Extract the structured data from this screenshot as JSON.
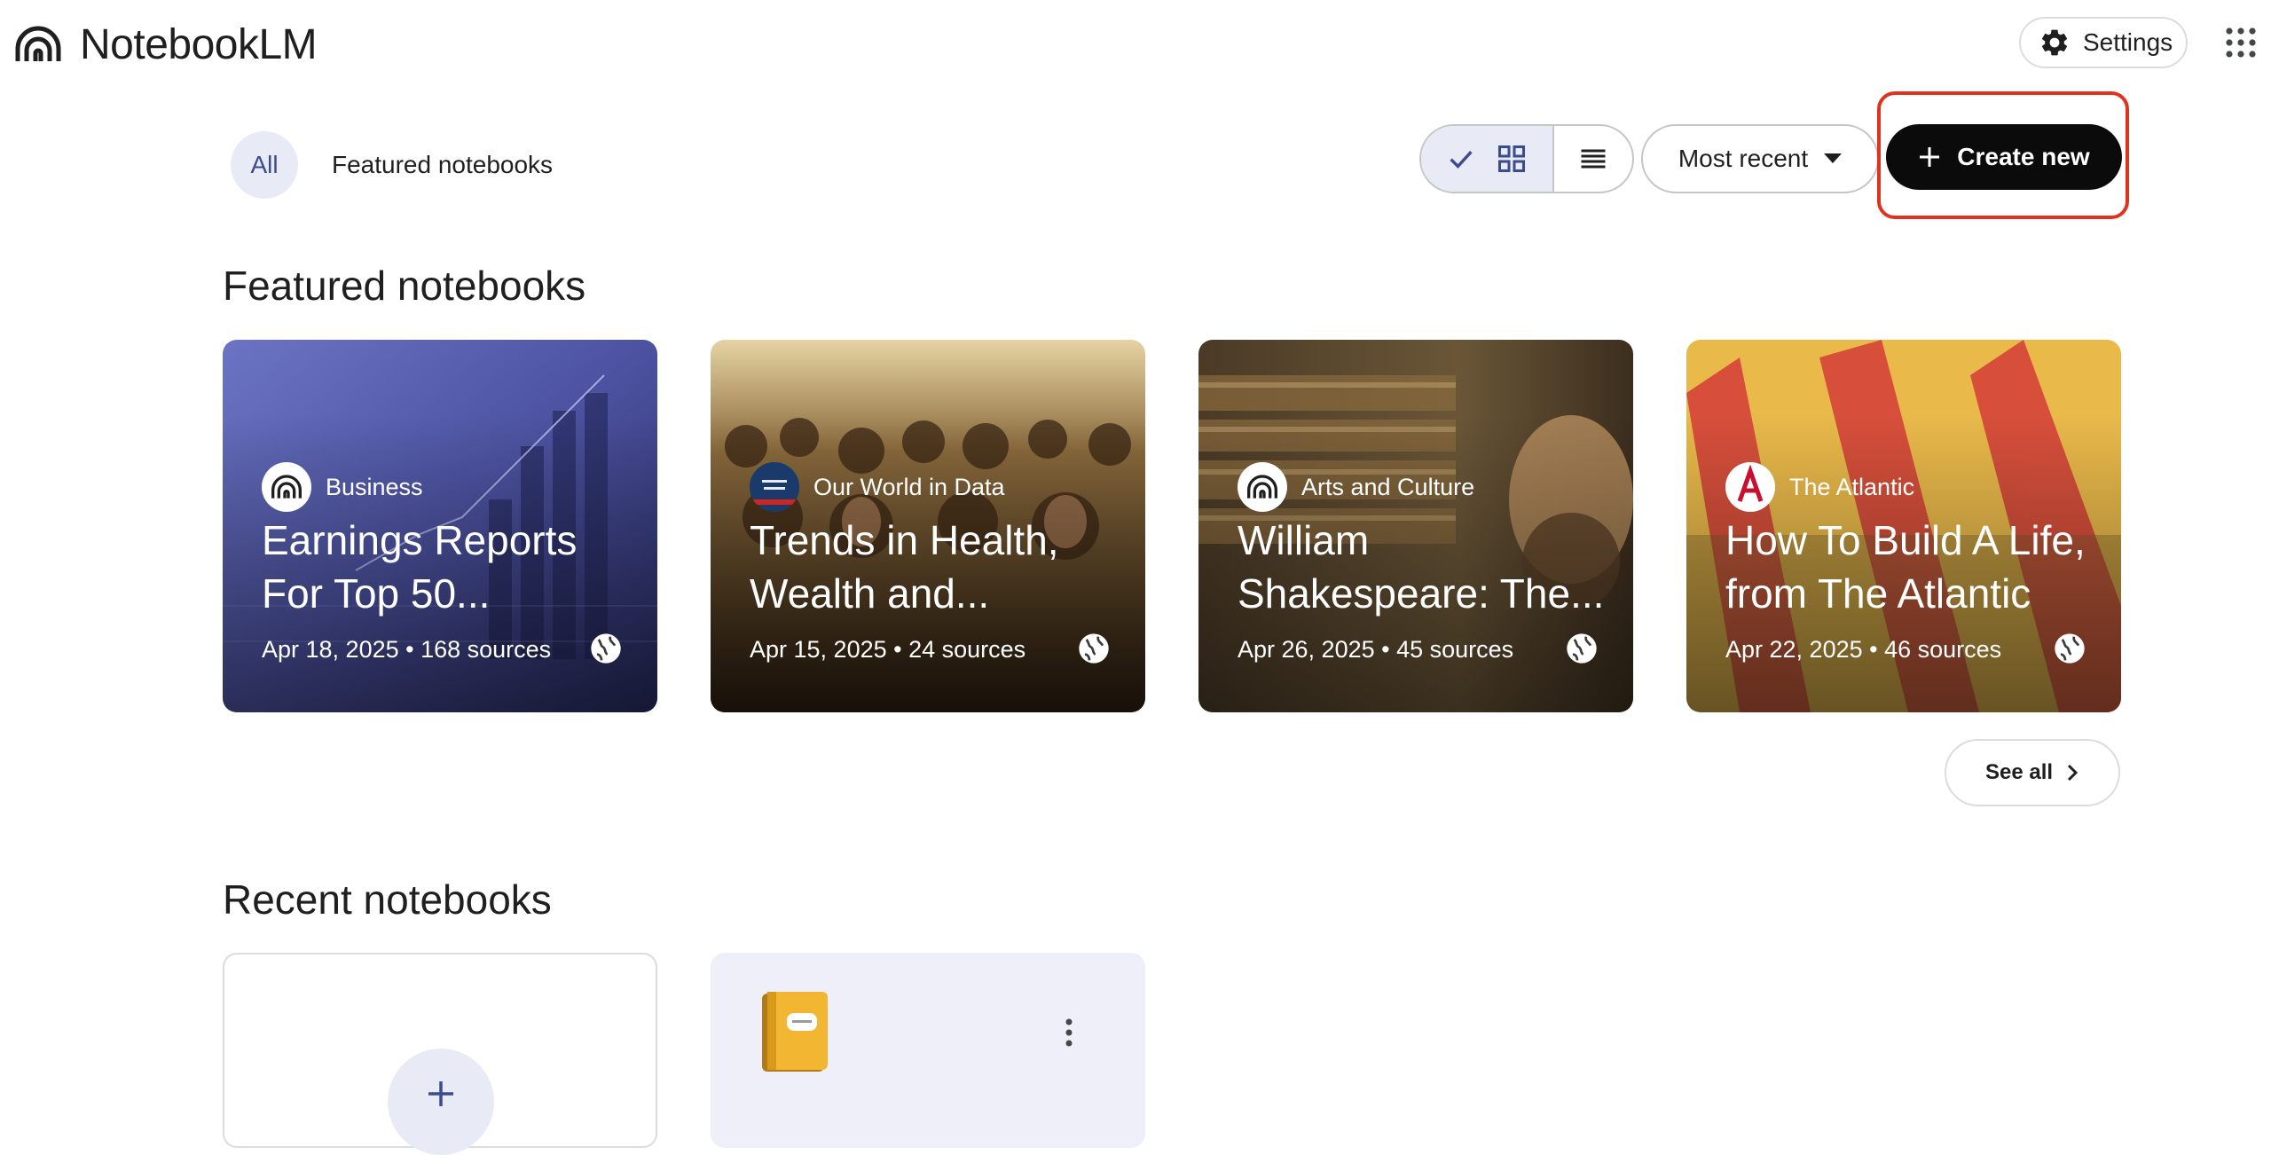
{
  "app": {
    "name": "NotebookLM"
  },
  "header": {
    "settings_label": "Settings",
    "settings_icon": "gear-icon",
    "apps_icon": "apps-grid-icon"
  },
  "filters": {
    "all_label": "All",
    "featured_label": "Featured notebooks"
  },
  "toolbar": {
    "view_grid_icons": [
      "check-icon",
      "grid-view-icon"
    ],
    "view_list_icon": "list-view-icon",
    "sort_label": "Most recent",
    "create_label": "Create new",
    "create_icon": "plus-icon"
  },
  "featured": {
    "title": "Featured notebooks",
    "see_all_label": "See all",
    "cards": [
      {
        "source": "Business",
        "title": "Earnings Reports For Top 50...",
        "meta": "Apr 18, 2025 • 168 sources"
      },
      {
        "source": "Our World in Data",
        "title": "Trends in Health, Wealth and...",
        "meta": "Apr 15, 2025 • 24 sources"
      },
      {
        "source": "Arts and Culture",
        "title": "William Shakespeare: The...",
        "meta": "Apr 26, 2025 • 45 sources"
      },
      {
        "source": "The Atlantic",
        "title": "How To Build A Life, from The Atlantic",
        "meta": "Apr 22, 2025 • 46 sources"
      }
    ]
  },
  "recent": {
    "title": "Recent notebooks",
    "notebook_icon": "notebook-emoji-icon",
    "menu_icon": "more-vert-icon"
  },
  "colors": {
    "accent_bg": "#e8eaf6",
    "create_bg": "#0b0b0b",
    "highlight": "#e0321f"
  }
}
